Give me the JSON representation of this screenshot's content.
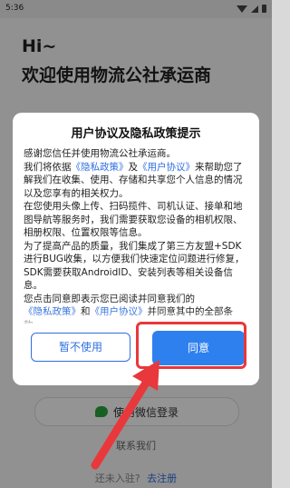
{
  "status_bar": {
    "time": "5:36",
    "icons": [
      "wifi-icon",
      "signal-icon",
      "battery-icon"
    ]
  },
  "page": {
    "greeting": "Hi~",
    "welcome": "欢迎使用物流公社承运商",
    "wechat_login_label": "使用微信登录",
    "contact_label": "联系我们",
    "register_question": "还未入驻?",
    "register_link": "去注册"
  },
  "dialog": {
    "title": "用户协议及隐私政策提示",
    "p1": "感谢您信任并使用物流公社承运商。",
    "p2_a": "我们将依据",
    "privacy_policy_link": "《隐私政策》",
    "p2_b": "及",
    "user_agreement_link": "《用户协议》",
    "p2_c": "来帮助您了解我们在收集、使用、存储和共享您个人信息的情况以及您享有的相关权力。",
    "p3": "在您使用头像上传、扫码揽件、司机认证、接单和地图导航等服务时，我们需要获取您设备的相机权限、相册权限、位置权限等信息。",
    "p4": "为了提高产品的质量，我们集成了第三方友盟+SDK进行BUG收集，以方便我们快速定位问题进行修复，SDK需要获取AndroidID、安装列表等相关设备信息。",
    "p5_a": "您点击同意即表示您已阅读并同意我们的",
    "p5_link1": "《隐私政策》",
    "p5_b": "和",
    "p5_link2": "《用户协议》",
    "p5_c": "并同意其中的全部条款。",
    "decline_label": "暂不使用",
    "agree_label": "同意"
  },
  "colors": {
    "accent": "#2f80ef",
    "link": "#2f6fe0",
    "annotation": "#e8383b",
    "wechat": "#2aa43d"
  }
}
